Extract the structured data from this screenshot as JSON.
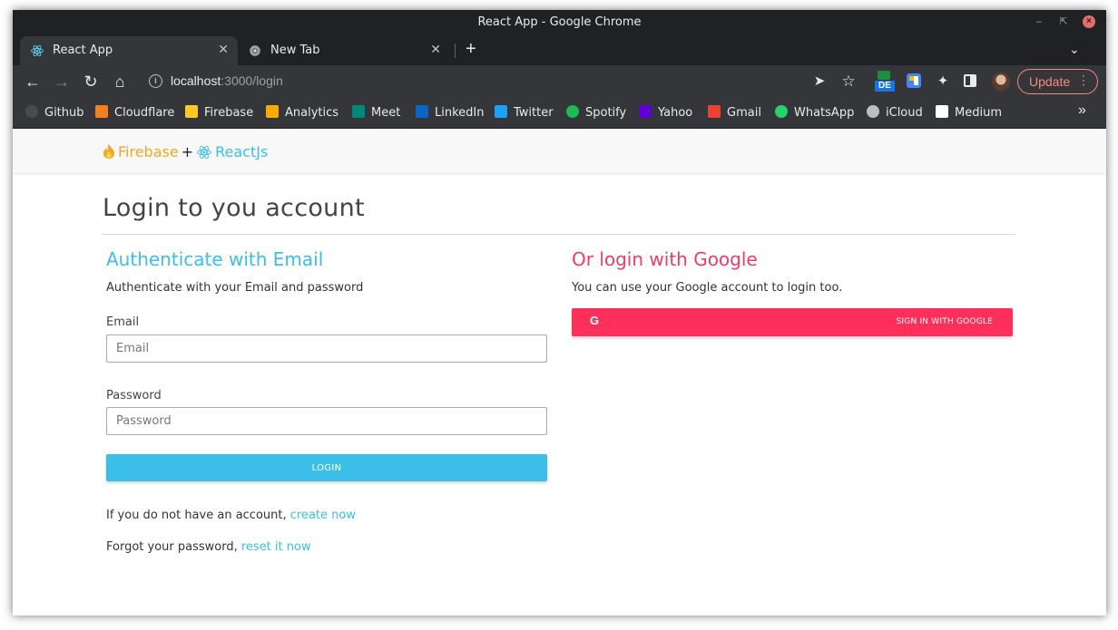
{
  "window": {
    "title": "React App - Google Chrome"
  },
  "tabs": [
    {
      "title": "React App",
      "active": true
    },
    {
      "title": "New Tab",
      "active": false
    }
  ],
  "toolbar": {
    "url_host": "localhost",
    "url_path": ":3000/login",
    "update_label": "Update",
    "extension_badge": "DE"
  },
  "bookmarks": [
    {
      "label": "Github",
      "icon": "github-icon",
      "color": "#4a4a4a"
    },
    {
      "label": "Cloudflare",
      "icon": "cloudflare-icon",
      "color": "#f38020"
    },
    {
      "label": "Firebase",
      "icon": "firebase-icon",
      "color": "#ffca28"
    },
    {
      "label": "Analytics",
      "icon": "analytics-icon",
      "color": "#f9ab00"
    },
    {
      "label": "Meet",
      "icon": "meet-icon",
      "color": "#00897b"
    },
    {
      "label": "LinkedIn",
      "icon": "linkedin-icon",
      "color": "#0a66c2"
    },
    {
      "label": "Twitter",
      "icon": "twitter-icon",
      "color": "#1da1f2"
    },
    {
      "label": "Spotify",
      "icon": "spotify-icon",
      "color": "#1db954"
    },
    {
      "label": "Yahoo",
      "icon": "yahoo-icon",
      "color": "#6001d2"
    },
    {
      "label": "Gmail",
      "icon": "gmail-icon",
      "color": "#ea4335"
    },
    {
      "label": "WhatsApp",
      "icon": "whatsapp-icon",
      "color": "#25d366"
    },
    {
      "label": "iCloud",
      "icon": "apple-icon",
      "color": "#bdbdbd"
    },
    {
      "label": "Medium",
      "icon": "medium-icon",
      "color": "#ffffff"
    }
  ],
  "app": {
    "brand_firebase": "Firebase",
    "brand_plus": "+",
    "brand_react": "ReactJs",
    "page_title": "Login to you account",
    "email_section": {
      "title": "Authenticate with Email",
      "description": "Authenticate with your Email and password",
      "email_label": "Email",
      "email_placeholder": "Email",
      "password_label": "Password",
      "password_placeholder": "Password",
      "login_button": "LOGIN"
    },
    "google_section": {
      "title": "Or login with Google",
      "description": "You can use your Google account to login too.",
      "button_icon": "G",
      "button_label": "SIGN IN WITH GOOGLE"
    },
    "register_text": "If you do not have an account, ",
    "register_link": "create now",
    "reset_text": "Forgot your password, ",
    "reset_link": "reset it now"
  },
  "colors": {
    "accent_blue": "#3bbfe8",
    "accent_red": "#ef3c66",
    "google_button": "#ff2f5b",
    "firebase_orange": "#f5a623"
  }
}
